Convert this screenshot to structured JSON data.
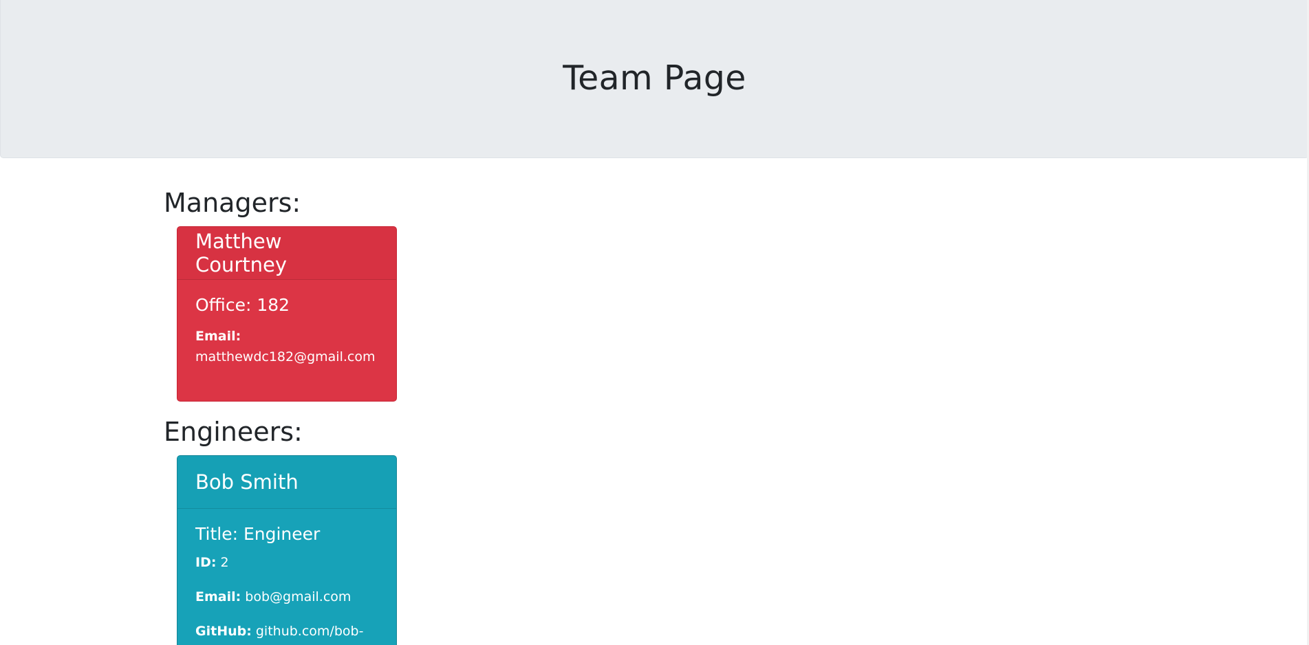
{
  "page": {
    "title": "Team Page"
  },
  "managers": {
    "heading": "Managers:",
    "cards": [
      {
        "name": "Matthew Courtney",
        "office": "Office: 182",
        "email_label": "Email:",
        "email": "matthewdc182@gmail.com"
      }
    ]
  },
  "engineers": {
    "heading": "Engineers:",
    "cards": [
      {
        "name": "Bob Smith",
        "title": "Title: Engineer",
        "id_label": "ID:",
        "id": "2",
        "email_label": "Email:",
        "email": "bob@gmail.com",
        "github_label": "GitHub:",
        "github": "github.com/bob-"
      }
    ]
  },
  "colors": {
    "manager_card": "#dc3545",
    "engineer_card": "#17a2b8",
    "header_bg": "#e9ecef"
  }
}
